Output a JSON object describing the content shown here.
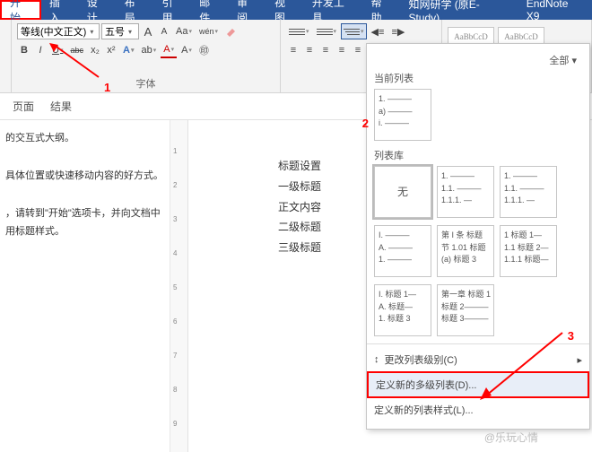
{
  "tabs": {
    "t0": "开始",
    "t1": "插入",
    "t2": "设计",
    "t3": "布局",
    "t4": "引用",
    "t5": "邮件",
    "t6": "审阅",
    "t7": "视图",
    "t8": "开发工具",
    "t9": "帮助",
    "t10": "知网研学 (原E-Study)",
    "t11": "EndNote X9"
  },
  "font": {
    "name": "等线(中文正文)",
    "size": "五号",
    "group_label": "字体",
    "b": "B",
    "i": "I",
    "u": "U",
    "abc": "abc",
    "x2": "x₂",
    "xs": "x²",
    "a_case": "Aa",
    "a_big": "A",
    "a_small": "A",
    "wen": "wén",
    "clear": "A",
    "highlight": "ab",
    "color": "A"
  },
  "subbar": {
    "p": "页面",
    "r": "结果"
  },
  "left": {
    "l1": "的交互式大纲。",
    "l2": "具体位置或快速移动内容的好方式。",
    "l3": "，请转到\"开始\"选项卡，并向文档中",
    "l4": "用标题样式。"
  },
  "doc": {
    "d1": "标题设置",
    "d2": "一级标题",
    "d3": "正文内容",
    "d4": "二级标题",
    "d5": "三级标题"
  },
  "dd": {
    "all": "全部 ▾",
    "cur": "当前列表",
    "lib": "列表库",
    "none": "无",
    "change": "更改列表级别(C)",
    "define": "定义新的多级列表(D)...",
    "style": "定义新的列表样式(L)...",
    "cur_t": "1. ―――\na) ―――\ni. ―――",
    "lib1": "1. ―――\n1.1. ―――\n1.1.1. ―",
    "lib2": "1. ―――\n1.1. ―――\n1.1.1. ―",
    "lib3": "I. ―――\nA. ―――\n1. ―――",
    "lib4": "第 I 条 标题\n节 1.01 标题\n(a) 标题 3",
    "lib5": "1 标题 1―\n1.1 标题 2―\n1.1.1 标题―",
    "lib6": "I. 标题 1―\nA. 标题―\n1. 标题 3",
    "lib7": "第一章 标题 1\n标题 2―――\n标题 3―――"
  },
  "anno": {
    "n1": "1",
    "n2": "2",
    "n3": "3"
  },
  "styles": {
    "s1": "AaBbCcD",
    "s2": "AaBbCcD"
  },
  "wm": "@乐玩心情"
}
